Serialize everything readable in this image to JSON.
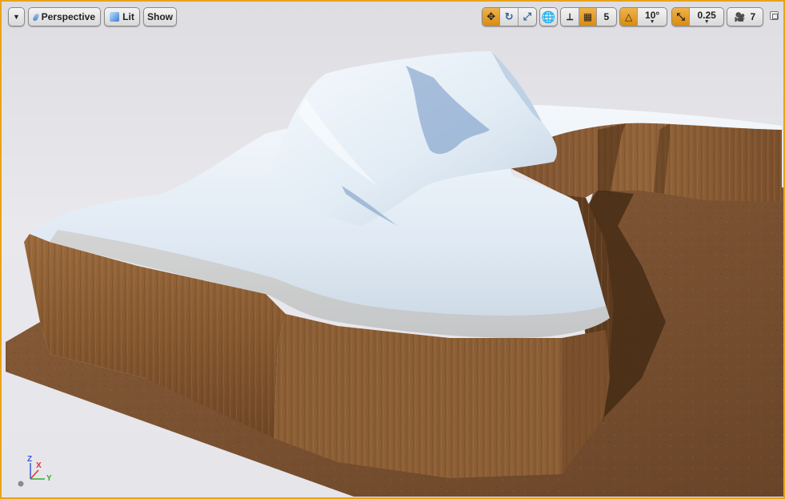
{
  "viewport": {
    "view_mode_label": "Perspective",
    "lit_label": "Lit",
    "show_label": "Show",
    "grid_snap_value": "5",
    "rotation_snap_value": "10°",
    "scale_snap_value": "0.25",
    "camera_speed_value": "7"
  },
  "axis_gizmo": {
    "z": "Z",
    "x": "X",
    "y": "Y"
  },
  "colors": {
    "accent": "#e8a317",
    "snow": "#e4eef7",
    "cliff": "#8a5a32",
    "ground": "#7a5232"
  }
}
